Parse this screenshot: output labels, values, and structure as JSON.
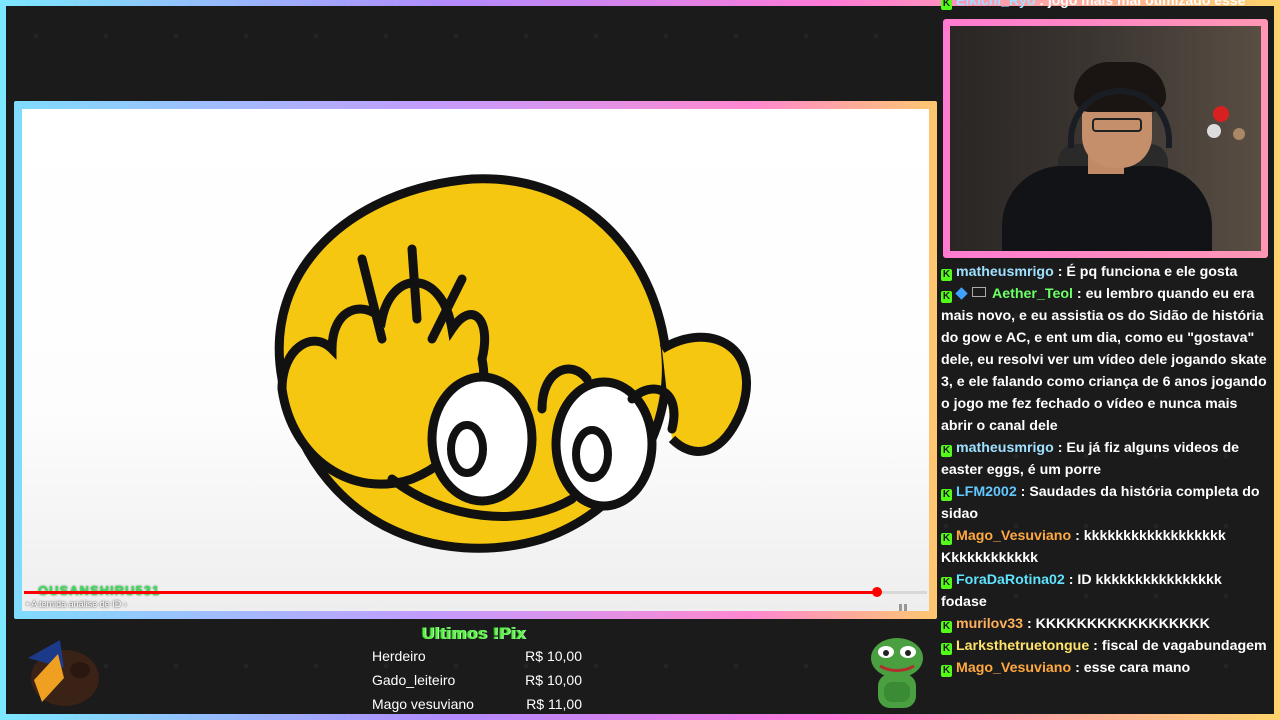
{
  "chat_partial_top": {
    "user": "Eikichi_Ryo",
    "text": "jogo mais mal otimizado esse"
  },
  "video": {
    "watermark": "OUSANSHIRU531",
    "chapter_title": "• A temida análise de ID ›",
    "progress_fraction": 0.945
  },
  "chat": {
    "messages": [
      {
        "user": "matheusmrigo",
        "color": "#9fe0ff",
        "badges": [
          "kick"
        ],
        "text": "É pq funciona e ele gosta"
      },
      {
        "user": "Aether_Teol",
        "color": "#6cff66",
        "badges": [
          "kick",
          "cube",
          "sub"
        ],
        "text": "eu lembro quando eu era mais novo, e eu assistia os do Sidão de história do gow e AC, e ent um dia, como eu \"gostava\" dele, eu resolvi ver um vídeo dele jogando skate 3, e ele falando como criança de 6 anos jogando o jogo me fez fechado o vídeo e nunca mais abrir o canal dele"
      },
      {
        "user": "matheusmrigo",
        "color": "#9fe0ff",
        "badges": [
          "kick"
        ],
        "text": "Eu já fiz alguns videos de easter eggs, é um porre"
      },
      {
        "user": "LFM2002",
        "color": "#62c8ff",
        "badges": [
          "kick"
        ],
        "text": "Saudades da história completa do sidao"
      },
      {
        "user": "Mago_Vesuviano",
        "color": "#ffa840",
        "badges": [
          "kick"
        ],
        "text": "kkkkkkkkkkkkkkkkkk Kkkkkkkkkkkk"
      },
      {
        "user": "ForaDaRotina02",
        "color": "#5fe3ff",
        "badges": [
          "kick"
        ],
        "text": "ID kkkkkkkkkkkkkkkk fodase"
      },
      {
        "user": "murilov33",
        "color": "#ffb05a",
        "badges": [
          "kick"
        ],
        "text": "KKKKKKKKKKKKKKKKK"
      },
      {
        "user": "Larksthetruetongue",
        "color": "#ffe36a",
        "badges": [
          "kick"
        ],
        "text": "fiscal de vagabundagem"
      },
      {
        "user": "Mago_Vesuviano",
        "color": "#ffa840",
        "badges": [
          "kick"
        ],
        "text": "esse cara mano"
      }
    ]
  },
  "pix": {
    "title": "Ultimos !Pix",
    "rows": [
      {
        "name": "Herdeiro",
        "amount": "R$ 10,00"
      },
      {
        "name": "Gado_leiteiro",
        "amount": "R$ 10,00"
      },
      {
        "name": "Mago vesuviano",
        "amount": "R$ 11,00"
      }
    ]
  },
  "colors": {
    "kick_green": "#53fc18",
    "progress_red": "#ff0000",
    "pix_green": "#5df04a"
  }
}
